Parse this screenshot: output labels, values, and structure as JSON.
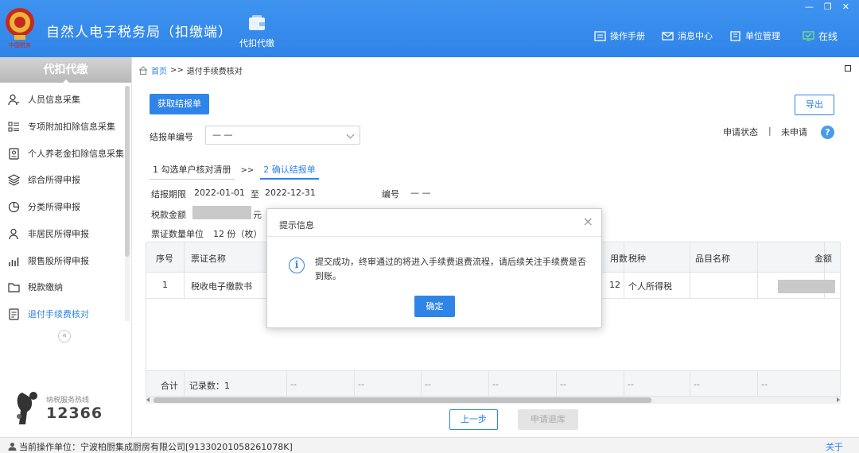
{
  "header": {
    "app_title": "自然人电子税务局（扣缴端）",
    "logo_caption": "中国税务",
    "nav_tab_label": "代扣代缴",
    "links": {
      "manual": "操作手册",
      "messages": "消息中心",
      "unit_mgmt": "单位管理",
      "online": "在线"
    },
    "window_controls": {
      "min": "—",
      "restore": "❐",
      "close": "✕"
    }
  },
  "sidebar": {
    "title": "代扣代缴",
    "items": [
      {
        "label": "人员信息采集",
        "icon": "person-icon"
      },
      {
        "label": "专项附加扣除信息采集",
        "icon": "list-icon"
      },
      {
        "label": "个人养老金扣除信息采集",
        "icon": "card-icon"
      },
      {
        "label": "综合所得申报",
        "icon": "layers-icon"
      },
      {
        "label": "分类所得申报",
        "icon": "pie-icon"
      },
      {
        "label": "非居民所得申报",
        "icon": "person-outline-icon"
      },
      {
        "label": "限售股所得申报",
        "icon": "bar-icon"
      },
      {
        "label": "税款缴纳",
        "icon": "folder-icon"
      },
      {
        "label": "退付手续费核对",
        "icon": "document-icon"
      }
    ],
    "active_index": 8,
    "collapse_label": "«",
    "hotline_label": "纳税服务热线",
    "hotline_number": "12366"
  },
  "breadcrumb": {
    "home": "首页",
    "sep": ">>",
    "current": "退付手续费核对"
  },
  "toolbar": {
    "fetch_button": "获取结报单",
    "export_button": "导出"
  },
  "filter": {
    "report_no_label": "结报单编号",
    "report_no_value": "— —",
    "status_label": "申请状态",
    "status_sep": "|",
    "status_value": "未申请",
    "help": "?"
  },
  "steps": {
    "step1": "1 勾选单户核对清册",
    "sep": ">>",
    "step2": "2 确认结报单"
  },
  "details": {
    "period_label": "结报期限",
    "period_start": "2022-01-01",
    "period_to": "至",
    "period_end": "2022-12-31",
    "number_label": "编号",
    "number_value": "— —",
    "tax_amount_label": "税款金额",
    "tax_amount_unit": "元",
    "ticket_count_label": "票证数量单位",
    "ticket_count_value": "12 份（枚）"
  },
  "table": {
    "headers": {
      "seq": "序号",
      "ticket_name": "票证名称",
      "count": "用数",
      "tax_type": "税种",
      "item_name": "品目名称",
      "amount": "金额"
    },
    "rows": [
      {
        "seq": "1",
        "ticket_name": "税收电子缴款书",
        "count": "12",
        "tax_type": "个人所得税",
        "item_name": ""
      }
    ],
    "footer": {
      "total_label": "合计",
      "record_count": "记录数：1",
      "placeholder": "--"
    }
  },
  "pager": {
    "prev_button": "上一步",
    "submit_button": "申请退库"
  },
  "modal": {
    "title": "提示信息",
    "close": "×",
    "icon": "i",
    "message": "提交成功，终审通过的将进入手续费退费流程，请后续关注手续费是否到账。",
    "ok_button": "确定"
  },
  "statusbar": {
    "text": "当前操作单位：宁波柏厨集成厨房有限公司[91330201058261078K]",
    "about": "关于"
  },
  "colors": {
    "primary": "#2f84e8",
    "header": "#3a8eec"
  }
}
